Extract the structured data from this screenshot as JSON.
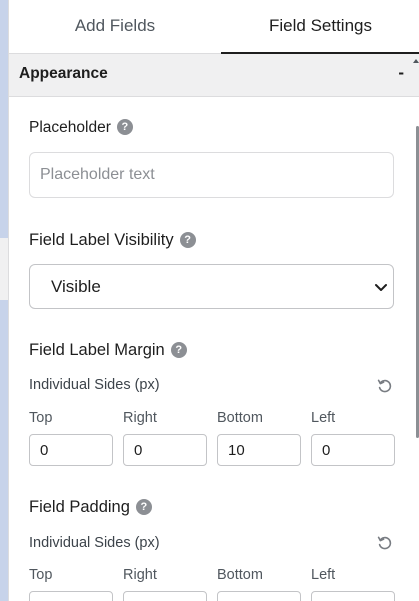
{
  "tabs": {
    "add_fields": "Add Fields",
    "field_settings": "Field Settings"
  },
  "section": {
    "title": "Appearance",
    "toggle": "-"
  },
  "placeholder": {
    "label": "Placeholder",
    "help": "?",
    "input_value": "",
    "input_placeholder": "Placeholder text"
  },
  "label_visibility": {
    "label": "Field Label Visibility",
    "help": "?",
    "selected": "Visible"
  },
  "label_margin": {
    "label": "Field Label Margin",
    "help": "?",
    "sub_label": "Individual Sides (px)",
    "sides": {
      "top": "Top",
      "right": "Right",
      "bottom": "Bottom",
      "left": "Left"
    },
    "values": {
      "top": "0",
      "right": "0",
      "bottom": "10",
      "left": "0"
    }
  },
  "field_padding": {
    "label": "Field Padding",
    "help": "?",
    "sub_label": "Individual Sides (px)",
    "sides": {
      "top": "Top",
      "right": "Right",
      "bottom": "Bottom",
      "left": "Left"
    }
  }
}
